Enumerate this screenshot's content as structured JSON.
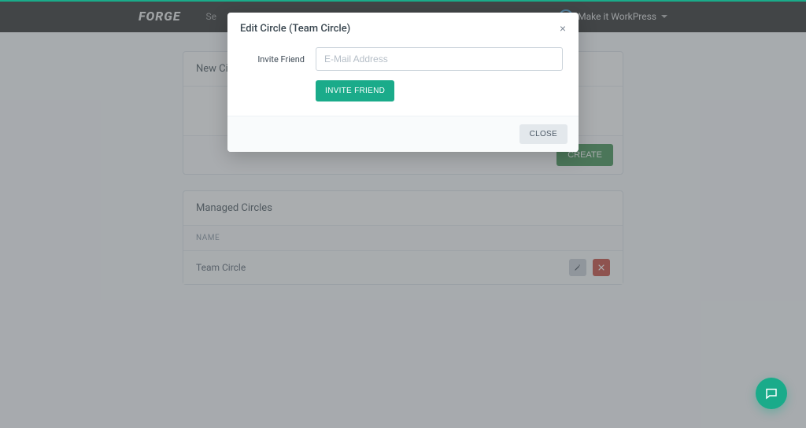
{
  "brand": "FORGE",
  "navbar": {
    "left_text": "Se",
    "user_label": "Make it WorkPress"
  },
  "panels": {
    "new_circle": {
      "title": "New Circle",
      "create_label": "CREATE"
    },
    "managed": {
      "title": "Managed Circles",
      "column_name": "NAME",
      "rows": [
        {
          "name": "Team Circle"
        }
      ]
    }
  },
  "modal": {
    "title": "Edit Circle (Team Circle)",
    "close_x": "×",
    "invite_label": "Invite Friend",
    "email_placeholder": "E-Mail Address",
    "invite_button": "INVITE FRIEND",
    "close_button": "CLOSE"
  }
}
